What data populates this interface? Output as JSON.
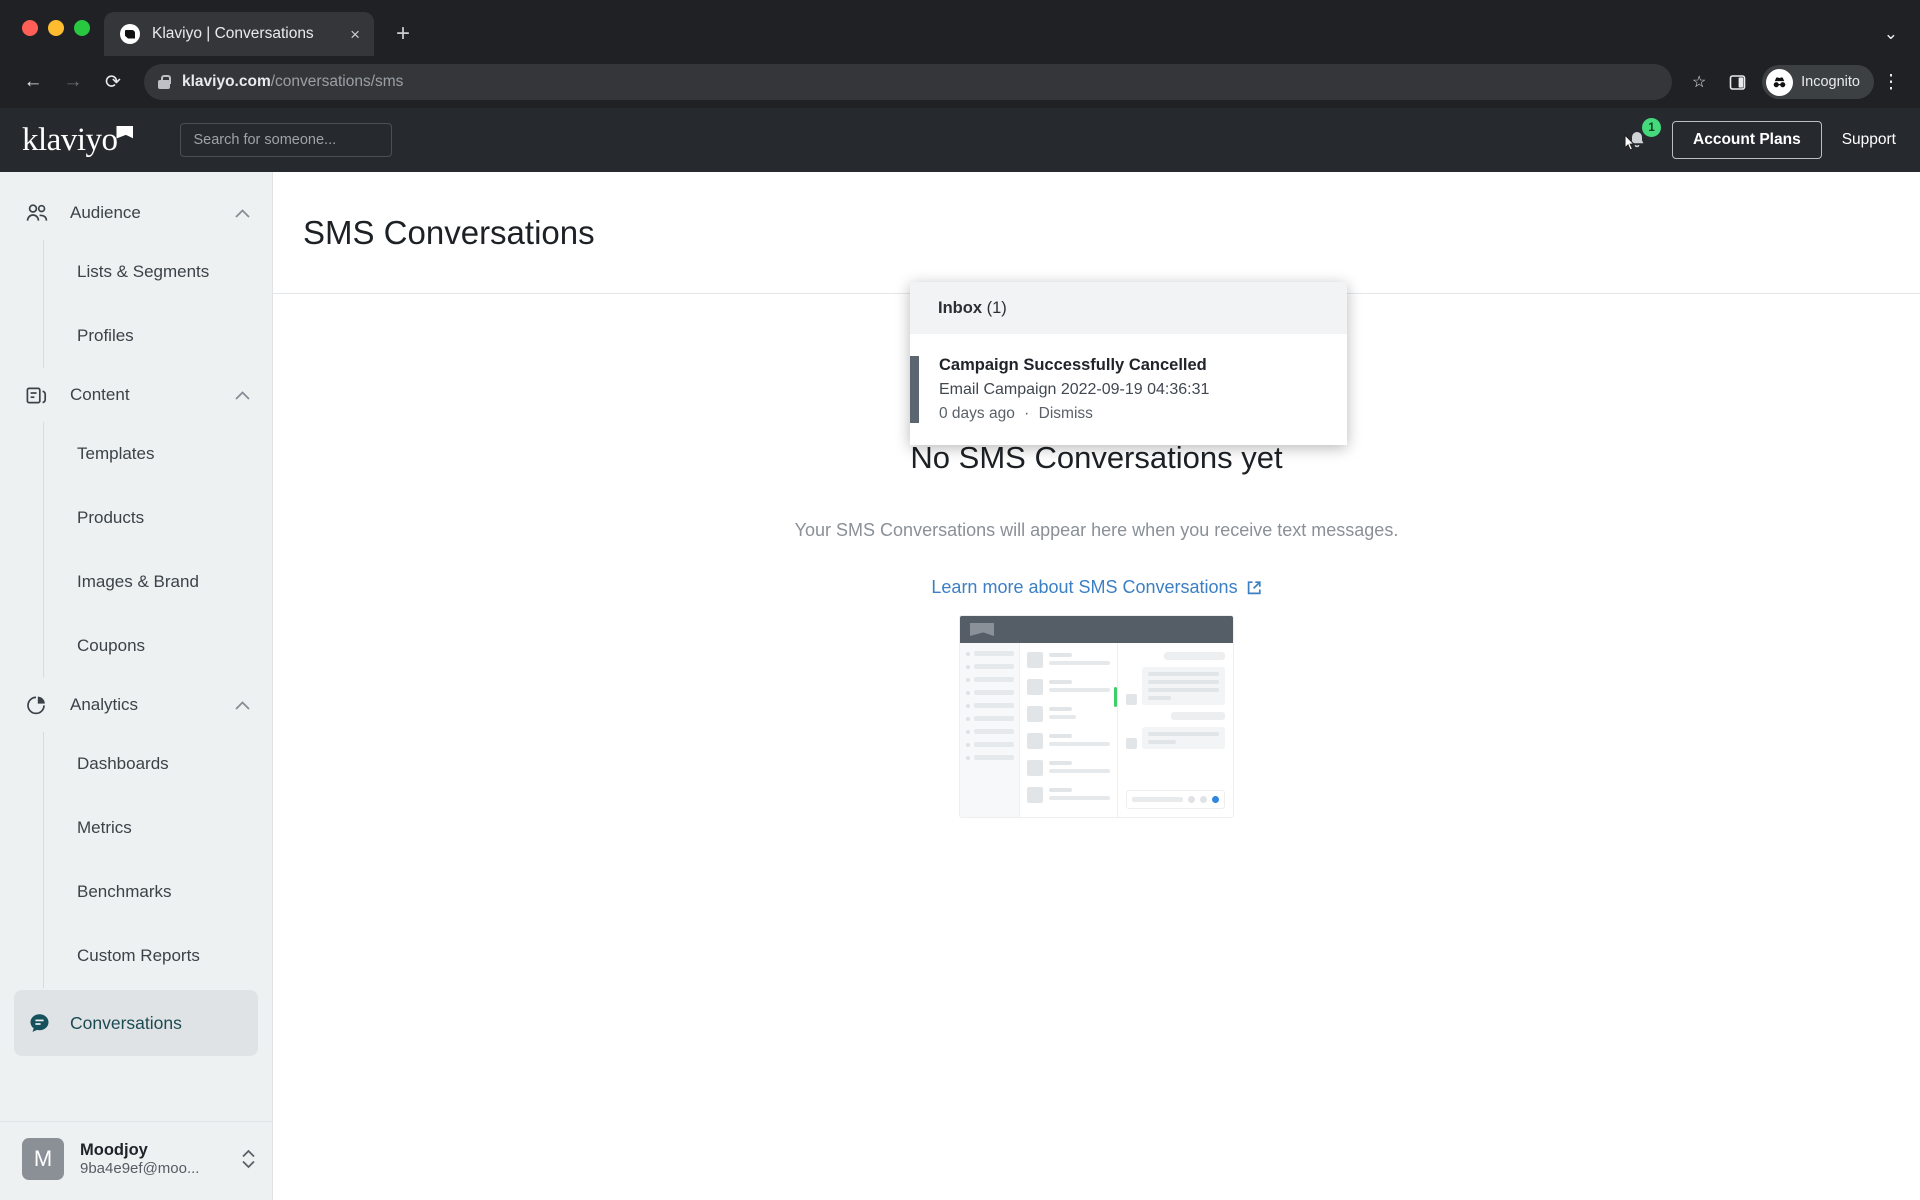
{
  "browser": {
    "tab_title": "Klaviyo | Conversations",
    "tab_close": "×",
    "new_tab": "+",
    "tab_list_chevron": "⌄",
    "back": "←",
    "forward": "→",
    "reload": "⟳",
    "url_domain": "klaviyo.com",
    "url_path": "/conversations/sms",
    "bookmark_icon": "☆",
    "incognito_label": "Incognito",
    "menu_icon": "⋮"
  },
  "topbar": {
    "logo_text": "klaviyo",
    "search_placeholder": "Search for someone...",
    "search_value": "",
    "notification_count": "1",
    "account_plans_label": "Account Plans",
    "support_label": "Support"
  },
  "notifications": {
    "header_label": "Inbox",
    "header_count": "(1)",
    "items": [
      {
        "title": "Campaign Successfully Cancelled",
        "subtitle": "Email Campaign 2022-09-19 04:36:31",
        "time": "0 days ago",
        "separator": "·",
        "dismiss": "Dismiss"
      }
    ]
  },
  "sidebar": {
    "groups": [
      {
        "label": "Audience",
        "icon": "people-icon",
        "chevron": "⌃",
        "items": [
          {
            "label": "Lists & Segments"
          },
          {
            "label": "Profiles"
          }
        ]
      },
      {
        "label": "Content",
        "icon": "content-icon",
        "chevron": "⌃",
        "items": [
          {
            "label": "Templates"
          },
          {
            "label": "Products"
          },
          {
            "label": "Images & Brand"
          },
          {
            "label": "Coupons"
          }
        ]
      },
      {
        "label": "Analytics",
        "icon": "analytics-icon",
        "chevron": "⌃",
        "items": [
          {
            "label": "Dashboards"
          },
          {
            "label": "Metrics"
          },
          {
            "label": "Benchmarks"
          },
          {
            "label": "Custom Reports"
          }
        ]
      }
    ],
    "active_item": {
      "label": "Conversations",
      "icon": "chat-icon",
      "accent_color": "#15525c"
    },
    "account": {
      "avatar_letter": "M",
      "name": "Moodjoy",
      "email": "9ba4e9ef@moo...",
      "switch_icon": "⌃⌄"
    }
  },
  "main": {
    "page_title": "SMS Conversations",
    "empty_heading": "No SMS Conversations yet",
    "empty_description": "Your SMS Conversations will appear here when you receive text messages.",
    "learn_more_label": "Learn more about SMS Conversations",
    "learn_more_icon": "external-link-icon"
  },
  "colors": {
    "brand_dark": "#262a2e",
    "sidebar_bg": "#eef1f2",
    "accent_teal": "#15525c",
    "badge_green": "#44d97b",
    "link_blue": "#3b7fc4"
  }
}
